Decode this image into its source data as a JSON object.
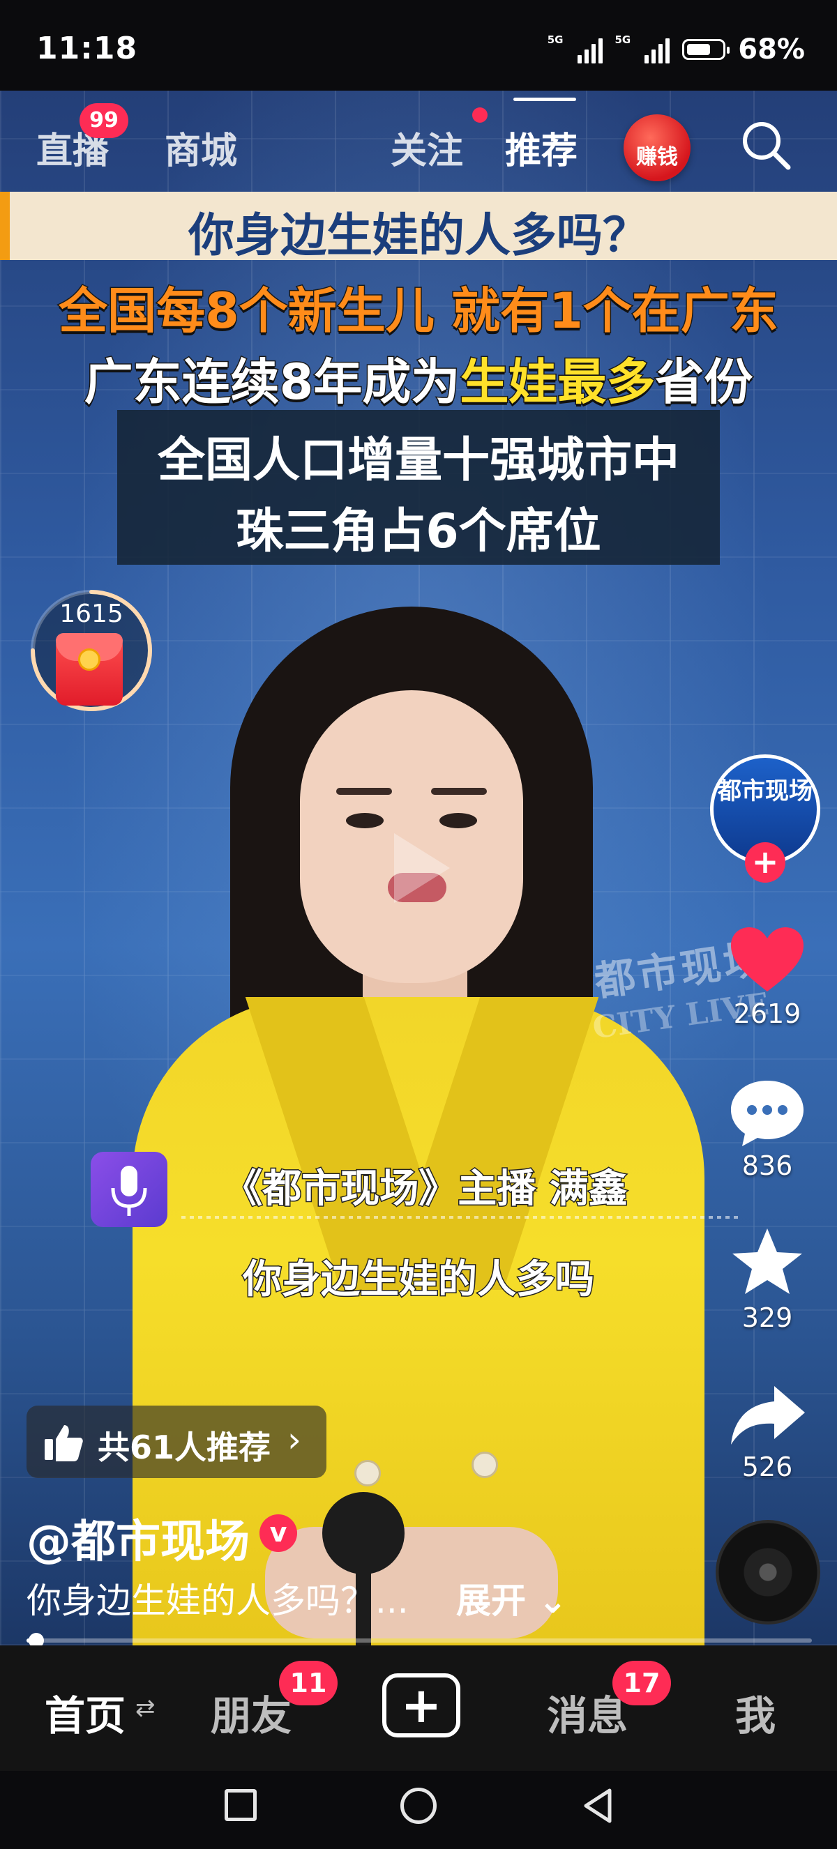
{
  "status_bar": {
    "time": "11:18",
    "network_1": "5G",
    "network_2": "5G",
    "battery_percent": "68%",
    "battery_level": 0.68
  },
  "top_nav": {
    "tabs": [
      {
        "label": "直播"
      },
      {
        "label": "商城"
      },
      {
        "label": "关注"
      },
      {
        "label": "推荐"
      }
    ],
    "active_tab": "推荐",
    "live_badge": "99",
    "earn_label": "赚钱",
    "search_icon": "search-icon"
  },
  "video": {
    "headline": "你身边生娃的人多吗？",
    "line1": "全国每8个新生儿 就有1个在广东",
    "line2_before": "广东连续8年成为",
    "line2_highlight": "生娃最多",
    "line2_after": "省份",
    "stat_line_1": "全国人口增量十强城市中",
    "stat_line_2": "珠三角占6个席位",
    "reward_count": "1615",
    "reward_progress": 0.75,
    "watermark": "都市现场",
    "watermark_sub": "CITY LIVE",
    "subtitle_1": "《都市现场》主播 满鑫",
    "subtitle_2": "你身边生娃的人多吗"
  },
  "actions": {
    "avatar_text": "都市现场",
    "likes": "2619",
    "comments": "836",
    "favorites": "329",
    "shares": "526"
  },
  "recommend": {
    "label": "共61人推荐"
  },
  "author": {
    "name": "@都市现场",
    "verified": "v",
    "caption": "你身边生娃的人多吗？...",
    "caption_more": "展开"
  },
  "playback": {
    "progress": 0.012
  },
  "bottom_tabs": {
    "home": "首页",
    "friends": "朋友",
    "friends_badge": "11",
    "create": "+",
    "messages": "消息",
    "messages_badge": "17",
    "me": "我"
  },
  "colors": {
    "accent_red": "#fe2c55",
    "headline_orange": "#ff8c1a",
    "highlight_yellow": "#ffe12a",
    "headline_blue": "#1b3e7c"
  }
}
